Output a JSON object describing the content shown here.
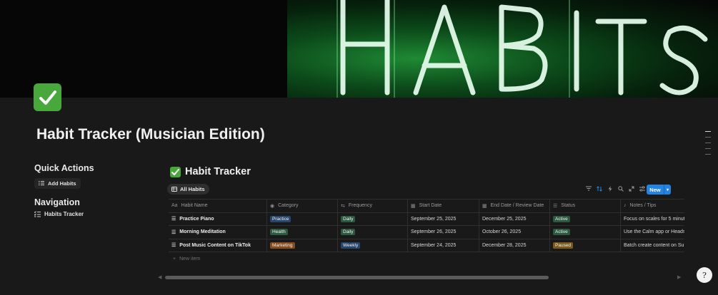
{
  "cover": {
    "word": "HABITS"
  },
  "page": {
    "icon": "check-mark-icon",
    "title": "Habit Tracker (Musician Edition)"
  },
  "quick_actions": {
    "heading": "Quick Actions",
    "add_button": "Add Habits"
  },
  "navigation": {
    "heading": "Navigation",
    "link": "Habits Tracker"
  },
  "database": {
    "title": "Habit Tracker",
    "view_tab": "All Habits",
    "new_button": "New",
    "new_item": "New item",
    "accent_color": "#2383e2",
    "columns": [
      "Habit Name",
      "Category",
      "Frequency",
      "Start Date",
      "End Date / Review Date",
      "Status",
      "Notes / Tips"
    ],
    "rows": [
      {
        "name": "Practice Piano",
        "category": "Practice",
        "frequency": "Daily",
        "start": "September 25, 2025",
        "end": "December 25, 2025",
        "status": "Active",
        "notes": "Focus on scales for 5 minut"
      },
      {
        "name": "Morning Meditation",
        "category": "Health",
        "frequency": "Daily",
        "start": "September 26, 2025",
        "end": "October 26, 2025",
        "status": "Active",
        "notes": "Use the Calm app or Heads"
      },
      {
        "name": "Post Music Content on TikTok",
        "category": "Marketing",
        "frequency": "Weekly",
        "start": "September 24, 2025",
        "end": "December 28, 2025",
        "status": "Paused",
        "notes": "Batch create content on Su"
      }
    ]
  },
  "help_button": "?"
}
